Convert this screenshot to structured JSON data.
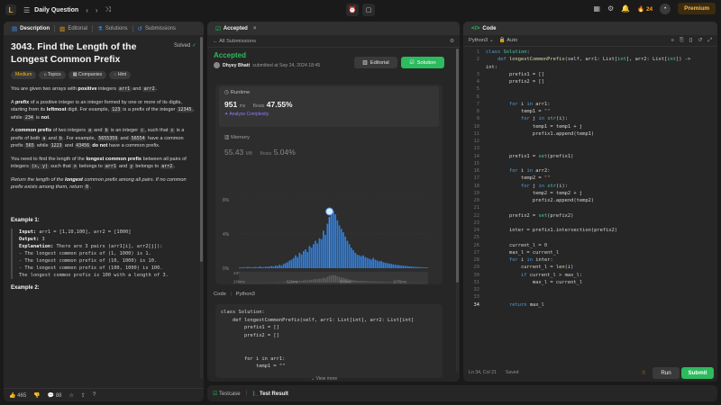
{
  "nav": {
    "logo_glyph": "L",
    "list_glyph": "☰",
    "title": "Daily Question",
    "prev_glyph": "‹",
    "next_glyph": "›",
    "shuffle_glyph": "⤨",
    "center_icons": [
      "⏰",
      "▢"
    ],
    "right_icons": [
      "▦",
      "⚙",
      "🔔"
    ],
    "streak_icon": "🔥",
    "streak": "24",
    "avatar_glyph": "•",
    "premium": "Premium"
  },
  "left": {
    "tabs": [
      {
        "icon": "▤",
        "label": "Description"
      },
      {
        "icon": "▥",
        "label": "Editorial"
      },
      {
        "icon": "⚗",
        "label": "Solutions"
      },
      {
        "icon": "↺",
        "label": "Submissions"
      }
    ],
    "title": "3043. Find the Length of the Longest Common Prefix",
    "solved": "Solved",
    "solved_glyph": "✓",
    "tags": [
      {
        "icon": "",
        "label": "Medium"
      },
      {
        "icon": "⌂",
        "label": "Topics"
      },
      {
        "icon": "▦",
        "label": "Companies"
      },
      {
        "icon": "◌",
        "label": "Hint"
      }
    ],
    "p1": {
      "a": "You are given two arrays with ",
      "b": "positive",
      "c": " integers ",
      "d": "arr1",
      "e": " and ",
      "f": "arr2",
      "g": "."
    },
    "p2": {
      "a": "A ",
      "b": "prefix",
      "c": " of a positive integer is an integer formed by one or more of its digits, starting from its ",
      "d": "leftmost",
      "e": " digit. For example, ",
      "f": "123",
      "g": " is a prefix of the integer ",
      "h": "12345",
      "i": ", while ",
      "j": "234",
      "k": " is ",
      "l": "not",
      "m": "."
    },
    "p3": {
      "a": "A ",
      "b": "common prefix",
      "c": " of two integers ",
      "d": "a",
      "e": " and ",
      "f": "b",
      "g": " is an integer ",
      "h": "c",
      "i": ", such that ",
      "j": "c",
      "k": " is a prefix of both ",
      "l": "a",
      "m": " and ",
      "n": "b",
      "o": ". For example, ",
      "p": "5655359",
      "q": " and ",
      "r": "56554",
      "s": " have a common prefix ",
      "t": "565",
      "u": " while ",
      "v": "1223",
      "w": " and ",
      "x": "43456",
      "y": " do not",
      "z": " have a common prefix."
    },
    "p4": {
      "a": "You need to find the length of the ",
      "b": "longest common prefix",
      "c": " between all pairs of integers ",
      "d": "(x, y)",
      "e": " such that ",
      "f": "x",
      "g": " belongs to ",
      "h": "arr1",
      "i": " and ",
      "j": "y",
      "k": " belongs to ",
      "l": "arr2",
      "m": "."
    },
    "p5": {
      "a": "Return the length of the ",
      "b": "longest",
      "c": " common prefix among all pairs. If no common prefix exists among them, return ",
      "d": "0",
      "e": "."
    },
    "example1_title": "Example 1:",
    "example1": {
      "input_label": "Input:",
      "input": " arr1 = [1,10,100], arr2 = [1000]",
      "output_label": "Output:",
      "output": " 3",
      "expl_label": "Explanation:",
      "expl": " There are 3 pairs (arr1[i], arr2[j]):",
      "lines": [
        "- The longest common prefix of (1, 1000) is 1.",
        "- The longest common prefix of (10, 1000) is 10.",
        "- The longest common prefix of (100, 1000) is 100.",
        "The longest common prefix is 100 with a length of 3."
      ]
    },
    "example2_title": "Example 2:",
    "footer": {
      "like_icon": "👍",
      "likes": "465",
      "dislike_icon": "👎",
      "comment_icon": "💬",
      "comments": "88",
      "star": "☆",
      "share": "⇪",
      "help": "?"
    }
  },
  "mid": {
    "tab_icon": "☑",
    "tab": "Accepted",
    "tab_close": "×",
    "sub_left_glyph": "←",
    "sub_left": "All Submissions",
    "sub_right_glyph": "⊘",
    "status": "Accepted",
    "author": "Dhyey Bhatt",
    "submitted": "submitted at Sep 24, 2024 18:45",
    "editorial_glyph": "▥",
    "editorial": "Editorial",
    "solution_glyph": "☑",
    "solution": "Solution",
    "runtime_glyph": "◷",
    "runtime_label": "Runtime",
    "runtime_value": "951",
    "runtime_unit": "ms",
    "beats_label": "Beats",
    "runtime_beats": "47.55%",
    "analyze_glyph": "✦",
    "analyze": "Analyze Complexity",
    "memory_glyph": "▥",
    "memory_label": "Memory",
    "memory_value": "55.43",
    "memory_unit": "MB",
    "memory_beats": "5.04%",
    "code_label": "Code",
    "code_lang": "Python3",
    "code_lines": [
      "class Solution:",
      "    def longestCommonPrefix(self, arr1: List[int], arr2: List[int]",
      "        prefix1 = []",
      "        prefix2 = []",
      "",
      "",
      "        for i in arr1:",
      "            temp1 = \"\""
    ],
    "view_more": "View more",
    "view_more_glyph": "⌄"
  },
  "chart_data": {
    "type": "bar",
    "yticks": [
      "8%",
      "4%",
      "0%"
    ],
    "xticks": [
      "249ms",
      "525ms",
      "800ms",
      "1076ms"
    ],
    "ylim": [
      0,
      8
    ],
    "x_start": 249,
    "x_end": 1230,
    "values": [
      0.1,
      0.1,
      0.12,
      0.1,
      0.15,
      0.12,
      0.1,
      0.12,
      0.15,
      0.1,
      0.2,
      0.15,
      0.12,
      0.18,
      0.15,
      0.2,
      0.25,
      0.2,
      0.3,
      0.25,
      0.4,
      0.3,
      0.5,
      0.6,
      0.7,
      0.9,
      1.0,
      1.2,
      1.5,
      1.3,
      1.8,
      1.6,
      2.0,
      2.2,
      1.9,
      2.6,
      2.4,
      2.8,
      3.2,
      2.9,
      3.5,
      3.4,
      4.4,
      3.9,
      5.2,
      6.0,
      6.4,
      6.7,
      6.3,
      5.6,
      5.0,
      4.6,
      4.2,
      3.7,
      3.2,
      2.8,
      2.4,
      2.1,
      1.8,
      1.6,
      1.5,
      1.4,
      1.5,
      1.3,
      1.2,
      1.1,
      1.0,
      1.2,
      1.0,
      0.9,
      0.8,
      0.85,
      0.7,
      0.65,
      0.6,
      0.55,
      0.5,
      0.45,
      0.4,
      0.38,
      0.35,
      0.3,
      0.3,
      0.25,
      0.25,
      0.2,
      0.2,
      0.18,
      0.15,
      0.15,
      0.12,
      0.12,
      0.1,
      0.1,
      0.1
    ],
    "highlight_index": 45,
    "bar_color": "#2f7fe0",
    "highlight_color": "#3b94ff"
  },
  "bottom": {
    "testcase_glyph": "☑",
    "testcase": "Testcase",
    "divider": "|",
    "result_glyph": "⟩_",
    "result": "Test Result"
  },
  "right": {
    "tab_glyph": "</>",
    "tab": "Code",
    "lang": "Python3",
    "lang_glyph": "⌄",
    "auto_glyph": "🔒",
    "auto": "Auto",
    "tool_icons": [
      "≡",
      "⎘",
      "{}",
      "↺",
      "⤢"
    ],
    "code": [
      {
        "n": "1",
        "html": "<span class='kw'>class</span> <span class='ty'>Solution</span>:"
      },
      {
        "n": "2",
        "html": "    <span class='kw'>def</span> <span class='fn'>longestCommonPrefix</span>(self, arr1: List[<span class='ty'>int</span>], arr2: List[<span class='ty'>int</span>]) -&gt;"
      },
      {
        "n": "",
        "html": "int:"
      },
      {
        "n": "3",
        "html": "        prefix1 = []"
      },
      {
        "n": "4",
        "html": "        prefix2 = []"
      },
      {
        "n": "5",
        "html": ""
      },
      {
        "n": "6",
        "html": ""
      },
      {
        "n": "7",
        "html": "        <span class='kw'>for</span> i <span class='kw'>in</span> arr1:"
      },
      {
        "n": "8",
        "html": "            temp1 = <span class='st'>\"\"</span>"
      },
      {
        "n": "9",
        "html": "            <span class='kw'>for</span> j <span class='kw'>in</span> <span class='ty'>str</span>(i):"
      },
      {
        "n": "10",
        "html": "                temp1 = temp1 + j"
      },
      {
        "n": "11",
        "html": "                prefix1.append(temp1)"
      },
      {
        "n": "12",
        "html": ""
      },
      {
        "n": "13",
        "html": ""
      },
      {
        "n": "14",
        "html": "        prefix1 = <span class='ty'>set</span>(prefix1)"
      },
      {
        "n": "15",
        "html": ""
      },
      {
        "n": "16",
        "html": "        <span class='kw'>for</span> i <span class='kw'>in</span> arr2:"
      },
      {
        "n": "17",
        "html": "            temp2 = <span class='st'>\"\"</span>"
      },
      {
        "n": "18",
        "html": "            <span class='kw'>for</span> j <span class='kw'>in</span> <span class='ty'>str</span>(i):"
      },
      {
        "n": "19",
        "html": "                temp2 = temp2 + j"
      },
      {
        "n": "20",
        "html": "                prefix2.append(temp2)"
      },
      {
        "n": "21",
        "html": ""
      },
      {
        "n": "22",
        "html": "        prefix2 = <span class='ty'>set</span>(prefix2)"
      },
      {
        "n": "23",
        "html": ""
      },
      {
        "n": "24",
        "html": "        inter = prefix1.intersection(prefix2)"
      },
      {
        "n": "25",
        "html": ""
      },
      {
        "n": "26",
        "html": "        current_l = <span class='nm'>0</span>"
      },
      {
        "n": "27",
        "html": "        max_l = current_l"
      },
      {
        "n": "28",
        "html": "        <span class='kw'>for</span> i <span class='kw'>in</span> inter:"
      },
      {
        "n": "29",
        "html": "            current_l = <span class='fn'>len</span>(i)"
      },
      {
        "n": "30",
        "html": "            <span class='kw'>if</span> current_l &gt; max_l:"
      },
      {
        "n": "31",
        "html": "                max_l = current_l"
      },
      {
        "n": "32",
        "html": ""
      },
      {
        "n": "33",
        "html": ""
      },
      {
        "n": "34",
        "html": "        <span class='kw'>return</span> max_l"
      }
    ],
    "current_line": "34",
    "status": "Ln 34, Col 21",
    "saved": "Saved",
    "cursor_glyph": "☝",
    "run": "Run",
    "submit": "Submit"
  }
}
